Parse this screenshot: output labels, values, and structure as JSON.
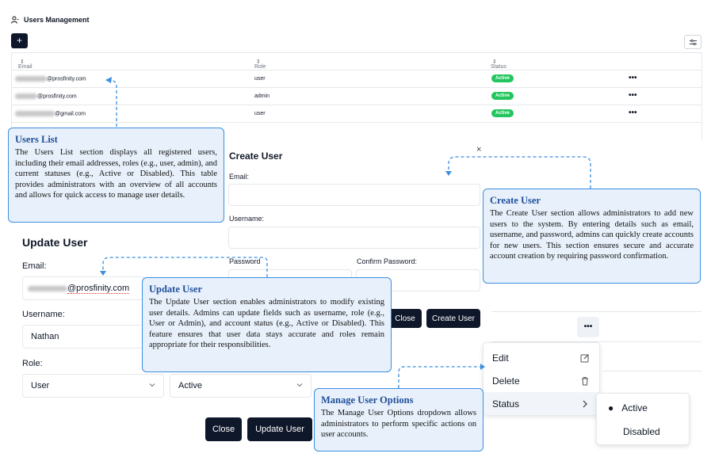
{
  "header": {
    "title": "Users Management",
    "add_label": "+"
  },
  "table": {
    "columns": [
      "Email",
      "Role",
      "Status"
    ],
    "rows": [
      {
        "email_domain": "@prosfinity.com",
        "role": "user",
        "status": "Active",
        "actions": "•••"
      },
      {
        "email_domain": "@prosfinity.com",
        "role": "admin",
        "status": "Active",
        "actions": "•••"
      },
      {
        "email_domain": "@gmail.com",
        "role": "user",
        "status": "Active",
        "actions": "•••"
      }
    ]
  },
  "create_user": {
    "title": "Create User",
    "close_icon": "×",
    "email_label": "Email:",
    "username_label": "Username:",
    "password_label": "Password",
    "confirm_password_label": "Confirm Password:",
    "close_label": "Close",
    "submit_label": "Create User"
  },
  "update_user": {
    "title": "Update User",
    "email_label": "Email:",
    "email_domain": "@prosfinity.com",
    "username_label": "Username:",
    "username_value": "Nathan",
    "role_label": "Role:",
    "role_value": "User",
    "status_value": "Active",
    "close_label": "Close",
    "submit_label": "Update User"
  },
  "actions_menu": {
    "trigger": "•••",
    "items": [
      "Edit",
      "Delete",
      "Status"
    ],
    "status_options": [
      "Active",
      "Disabled"
    ],
    "selected_status": "Active"
  },
  "callouts": {
    "users_list": {
      "title": "Users List",
      "body": "The Users List section displays all registered users, including their email addresses, roles (e.g., user, admin), and current statuses (e.g., Active or Disabled). This table provides administrators with an overview of all accounts and allows for quick access to manage user details."
    },
    "create_user": {
      "title": "Create User",
      "body": "The Create User section allows administrators to add new users to the system. By entering details such as email, username, and password, admins can quickly create accounts for new users. This section ensures secure and accurate account creation by requiring password confirmation."
    },
    "update_user": {
      "title": "Update User",
      "body": "The Update User section enables administrators to modify existing user details. Admins can update fields such as username, role (e.g., User or Admin), and account status (e.g., Active or Disabled). This feature ensures that user data stays accurate and roles remain appropriate for their responsibilities."
    },
    "manage_options": {
      "title": "Manage User Options",
      "body": "The Manage User Options dropdown allows administrators to perform specific actions on user accounts."
    }
  },
  "colors": {
    "primary_dark": "#0f172a",
    "active_badge": "#22c55e",
    "callout_border": "#3b8ee0",
    "callout_bg": "#e8f1fb",
    "callout_title": "#1f4e9a"
  }
}
